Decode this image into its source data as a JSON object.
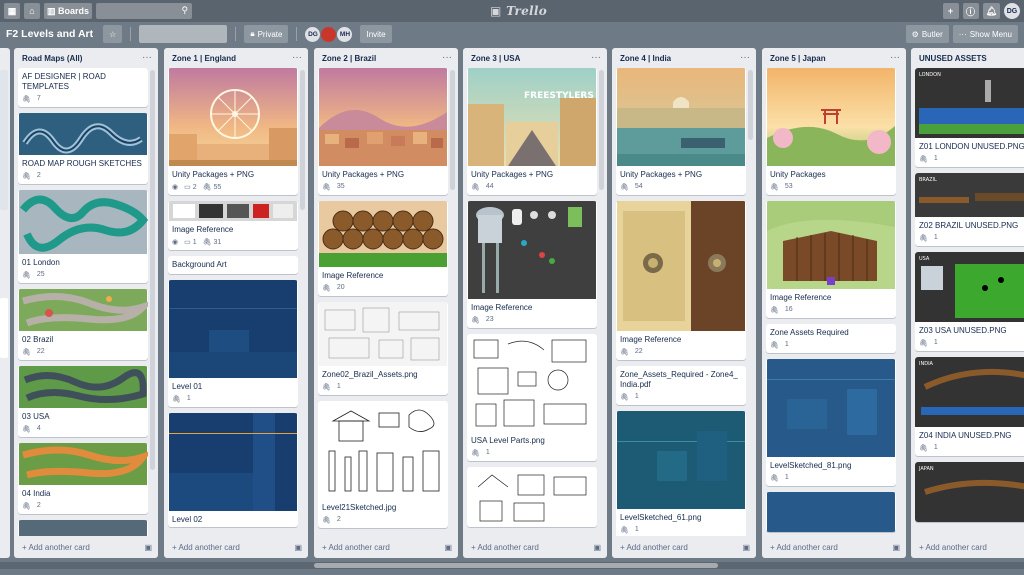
{
  "topbar": {
    "boards_label": "Boards",
    "logo_text": "Trello",
    "user_initials": "DG"
  },
  "board": {
    "title": "F2 Levels and Art",
    "visibility": "Private",
    "invite_label": "Invite",
    "members": [
      "DG",
      "MH"
    ],
    "butler_label": "Butler",
    "show_menu_label": "Show Menu"
  },
  "footer": {
    "add_card_label": "+ Add another card"
  },
  "lists": [
    {
      "title": "Road Maps (All)",
      "cards": [
        {
          "title": "AF DESIGNER | ROAD TEMPLATES",
          "attachments": "7"
        },
        {
          "title": "ROAD MAP ROUGH SKETCHES",
          "attachments": "2"
        },
        {
          "title": "01 London",
          "attachments": "25"
        },
        {
          "title": "02 Brazil",
          "attachments": "22"
        },
        {
          "title": "03 USA",
          "attachments": "4"
        },
        {
          "title": "04 India",
          "attachments": "2"
        }
      ]
    },
    {
      "title": "Zone 1 | England",
      "cards": [
        {
          "title": "Unity Packages + PNG",
          "watchers": "◉",
          "comments": "2",
          "attachments": "55"
        },
        {
          "title": "Image Reference",
          "watchers": "◉",
          "comments": "1",
          "attachments": "31"
        },
        {
          "title": "Background Art",
          "attachments": ""
        },
        {
          "title": "Level 01",
          "attachments": "1"
        },
        {
          "title": "Level 02",
          "attachments": ""
        }
      ]
    },
    {
      "title": "Zone 2 | Brazil",
      "cards": [
        {
          "title": "Unity Packages + PNG",
          "attachments": "35"
        },
        {
          "title": "Image Reference",
          "attachments": "20"
        },
        {
          "title": "Zone02_Brazil_Assets.png",
          "attachments": "1"
        },
        {
          "title": "Level21Sketched.jpg",
          "attachments": "2"
        }
      ]
    },
    {
      "title": "Zone 3 | USA",
      "cards": [
        {
          "title": "Unity Packages + PNG",
          "attachments": "44"
        },
        {
          "title": "Image Reference",
          "attachments": "23"
        },
        {
          "title": "USA Level Parts.png",
          "attachments": "1"
        }
      ]
    },
    {
      "title": "Zone 4 | India",
      "cards": [
        {
          "title": "Unity Packages + PNG",
          "attachments": "54"
        },
        {
          "title": "Image Reference",
          "attachments": "22"
        },
        {
          "title": "Zone_Assets_Required - Zone4_ India.pdf",
          "attachments": "1"
        },
        {
          "title": "LevelSketched_61.png",
          "attachments": "1"
        }
      ]
    },
    {
      "title": "Zone 5 | Japan",
      "cards": [
        {
          "title": "Unity Packages",
          "attachments": "53"
        },
        {
          "title": "Image Reference",
          "attachments": "16"
        },
        {
          "title": "Zone Assets Required",
          "attachments": "1"
        },
        {
          "title": "LevelSketched_81.png",
          "attachments": "1"
        }
      ]
    },
    {
      "title": "UNUSED ASSETS",
      "cards": [
        {
          "title": "Z01 LONDON UNUSED.PNG",
          "attachments": "1"
        },
        {
          "title": "Z02 BRAZIL UNUSED.PNG",
          "attachments": "1"
        },
        {
          "title": "Z03 USA UNUSED.PNG",
          "attachments": "1"
        },
        {
          "title": "Z04 INDIA UNUSED.PNG",
          "attachments": "1"
        }
      ]
    }
  ],
  "image_labels": {
    "freestylers": "FREESTYLERS",
    "london": "LONDON",
    "brazil": "BRAZIL",
    "usa": "USA",
    "india": "INDIA",
    "japan": "JAPAN"
  }
}
